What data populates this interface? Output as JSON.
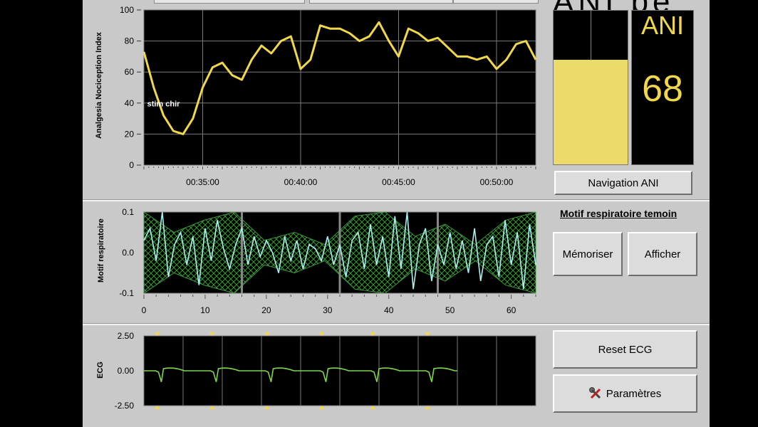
{
  "header": {
    "title": "ANI pe"
  },
  "ani_panel": {
    "label": "ANI",
    "value": "68",
    "level_percent": 68,
    "fill_color": "#ecdb6a"
  },
  "ani_chart": {
    "ylabel": "Analgesia Nociception Index",
    "yticks": [
      "100",
      "80",
      "60",
      "40",
      "20",
      "0"
    ],
    "xticks": [
      "00:35:00",
      "00:40:00",
      "00:45:00",
      "00:50:00"
    ],
    "annotation": "stim chir",
    "line_color": "#f0d84a",
    "navigation_button": "Navigation ANI"
  },
  "resp_chart": {
    "ylabel": "Motif respiratoire",
    "yticks": [
      "0.1",
      "0.0",
      "-0.1"
    ],
    "xticks": [
      "0",
      "10",
      "20",
      "30",
      "40",
      "50",
      "60"
    ],
    "witness_link": "Motif respiratoire temoin",
    "memorize_button": "Mémoriser",
    "display_button": "Afficher",
    "line_color": "#a8f0ee",
    "envelope_color": "#3a9a3a"
  },
  "ecg_chart": {
    "ylabel": "ECG",
    "yticks": [
      "2.50",
      "0.00",
      "-2.50"
    ],
    "line_color": "#7cd84a",
    "marker_color": "#f0d84a",
    "reset_button": "Reset ECG",
    "settings_button": "Paramètres",
    "settings_icon": "tools-icon"
  },
  "chart_data": [
    {
      "type": "line",
      "title": "",
      "ylabel": "Analgesia Nociception Index",
      "xlabel": "",
      "ylim": [
        0,
        100
      ],
      "xlim": [
        "00:32:00",
        "00:52:00"
      ],
      "grid": true,
      "annotation": {
        "text": "stim chir",
        "x": "00:32:10",
        "y": 37
      },
      "series": [
        {
          "x": [
            "00:32:00",
            "00:32:30",
            "00:33:00",
            "00:33:30",
            "00:34:00",
            "00:34:30",
            "00:35:00",
            "00:35:30",
            "00:36:00",
            "00:36:30",
            "00:37:00",
            "00:37:30",
            "00:38:00",
            "00:38:30",
            "00:39:00",
            "00:39:30",
            "00:40:00",
            "00:40:30",
            "00:41:00",
            "00:41:30",
            "00:42:00",
            "00:42:30",
            "00:43:00",
            "00:43:30",
            "00:44:00",
            "00:44:30",
            "00:45:00",
            "00:45:30",
            "00:46:00",
            "00:46:30",
            "00:47:00",
            "00:47:30",
            "00:48:00",
            "00:48:30",
            "00:49:00",
            "00:49:30",
            "00:50:00",
            "00:50:30",
            "00:51:00",
            "00:51:30",
            "00:52:00"
          ],
          "values": [
            73,
            50,
            32,
            22,
            20,
            30,
            50,
            63,
            66,
            58,
            55,
            68,
            77,
            72,
            80,
            83,
            62,
            68,
            90,
            88,
            88,
            85,
            80,
            83,
            92,
            80,
            70,
            88,
            85,
            80,
            82,
            76,
            70,
            70,
            68,
            70,
            62,
            68,
            78,
            80,
            68
          ]
        }
      ]
    },
    {
      "type": "line",
      "title": "",
      "ylabel": "Motif respiratoire",
      "xlabel": "",
      "ylim": [
        -0.1,
        0.1
      ],
      "xlim": [
        0,
        64
      ],
      "grid": true,
      "series": [
        {
          "x": [
            0,
            1,
            2,
            3,
            4,
            5,
            6,
            7,
            8,
            9,
            10,
            11,
            12,
            13,
            14,
            15,
            16,
            17,
            18,
            19,
            20,
            21,
            22,
            23,
            24,
            25,
            26,
            27,
            28,
            29,
            30,
            31,
            32,
            33,
            34,
            35,
            36,
            37,
            38,
            39,
            40,
            41,
            42,
            43,
            44,
            45,
            46,
            47,
            48,
            49,
            50,
            51,
            52,
            53,
            54,
            55,
            56,
            57,
            58,
            59,
            60,
            61,
            62,
            63,
            64
          ],
          "values": [
            0.03,
            0.06,
            -0.02,
            0.1,
            -0.06,
            0.02,
            0.05,
            -0.03,
            0.04,
            -0.08,
            0.06,
            -0.02,
            0.08,
            0.01,
            -0.04,
            0.02,
            0.06,
            -0.03,
            0.04,
            -0.01,
            0.03,
            0.0,
            -0.05,
            0.04,
            -0.02,
            0.03,
            -0.04,
            0.02,
            0.01,
            -0.02,
            0.04,
            -0.03,
            0.02,
            -0.06,
            0.03,
            0.05,
            -0.04,
            0.07,
            -0.03,
            0.04,
            -0.06,
            0.09,
            -0.04,
            0.1,
            -0.09,
            0.02,
            0.06,
            -0.07,
            0.02,
            -0.03,
            0.05,
            -0.04,
            0.03,
            -0.05,
            0.06,
            -0.07,
            0.02,
            0.04,
            -0.06,
            0.08,
            -0.03,
            0.05,
            -0.09,
            0.07,
            -0.03
          ]
        }
      ]
    },
    {
      "type": "line",
      "title": "",
      "ylabel": "ECG",
      "xlabel": "",
      "ylim": [
        -2.5,
        2.5
      ],
      "grid": true,
      "series": [
        {
          "beat_positions": [
            0.03,
            0.17,
            0.31,
            0.45,
            0.58,
            0.72
          ],
          "baseline": 0.0,
          "r_peak": -0.8,
          "t_wave": 0.3,
          "trace_end_fraction": 0.8
        }
      ]
    }
  ]
}
